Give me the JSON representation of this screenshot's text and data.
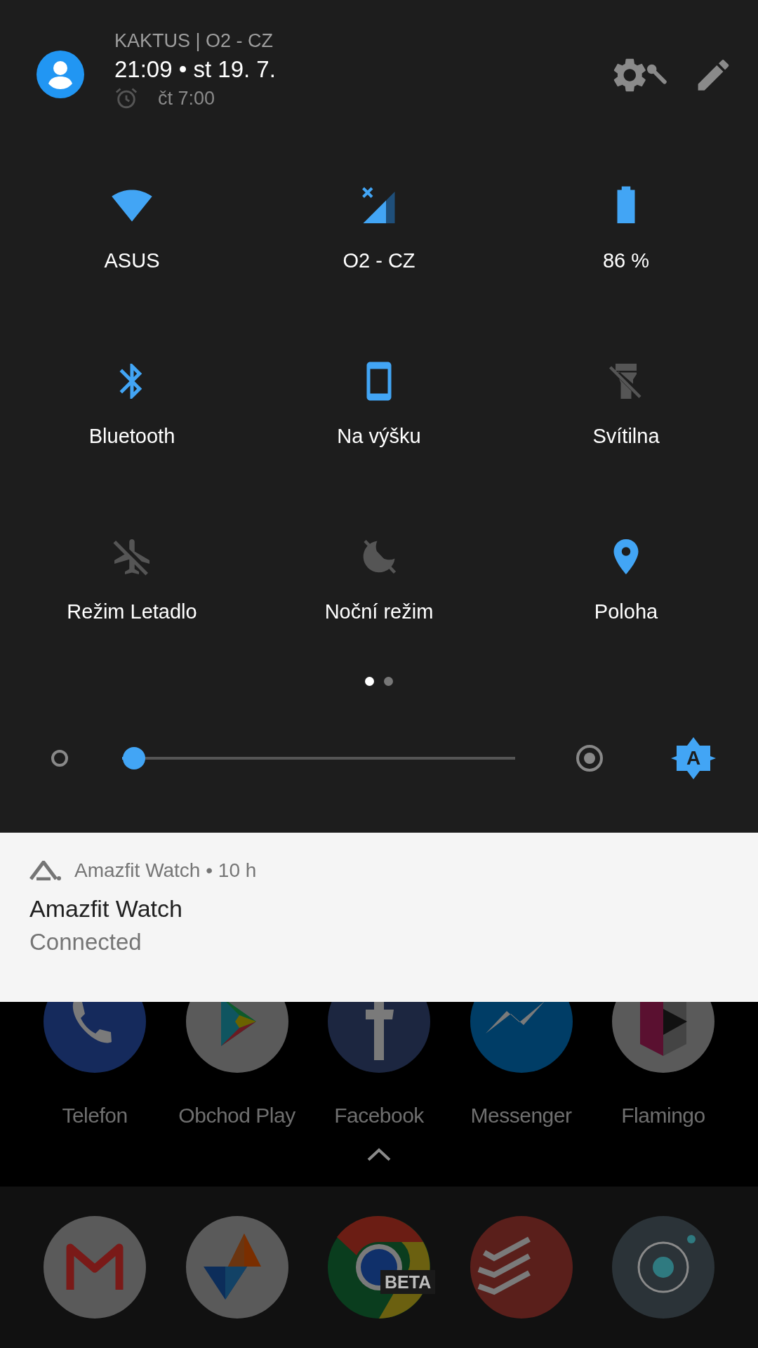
{
  "header": {
    "carrier": "KAKTUS | O2 - CZ",
    "datetime": "21:09 • st 19. 7.",
    "alarm": "čt 7:00"
  },
  "tiles": [
    {
      "kind": "wifi",
      "label": "ASUS",
      "on": true
    },
    {
      "kind": "cell",
      "label": "O2 - CZ",
      "on": true
    },
    {
      "kind": "battery",
      "label": "86 %",
      "on": true
    },
    {
      "kind": "bluetooth",
      "label": "Bluetooth",
      "on": true
    },
    {
      "kind": "rotation",
      "label": "Na výšku",
      "on": true
    },
    {
      "kind": "flashlight",
      "label": "Svítilna",
      "on": false
    },
    {
      "kind": "airplane",
      "label": "Režim Letadlo",
      "on": false
    },
    {
      "kind": "night",
      "label": "Noční režim",
      "on": false
    },
    {
      "kind": "location",
      "label": "Poloha",
      "on": true
    }
  ],
  "pages": [
    {
      "selected": true
    },
    {
      "selected": false
    }
  ],
  "brightness": {
    "level": 0.03,
    "auto": true,
    "auto_label": "A"
  },
  "notification": {
    "app": "Amazfit Watch",
    "separator": "•",
    "time": "10 h",
    "title": "Amazfit Watch",
    "text": "Connected"
  },
  "apps": [
    {
      "kind": "phone",
      "label": "Telefon"
    },
    {
      "kind": "play",
      "label": "Obchod Play"
    },
    {
      "kind": "facebook",
      "label": "Facebook"
    },
    {
      "kind": "messenger",
      "label": "Messenger"
    },
    {
      "kind": "flamingo",
      "label": "Flamingo"
    }
  ],
  "dock": [
    {
      "kind": "gmail"
    },
    {
      "kind": "triangles"
    },
    {
      "kind": "chrome",
      "badge": "BETA"
    },
    {
      "kind": "todoist"
    },
    {
      "kind": "camera"
    }
  ]
}
